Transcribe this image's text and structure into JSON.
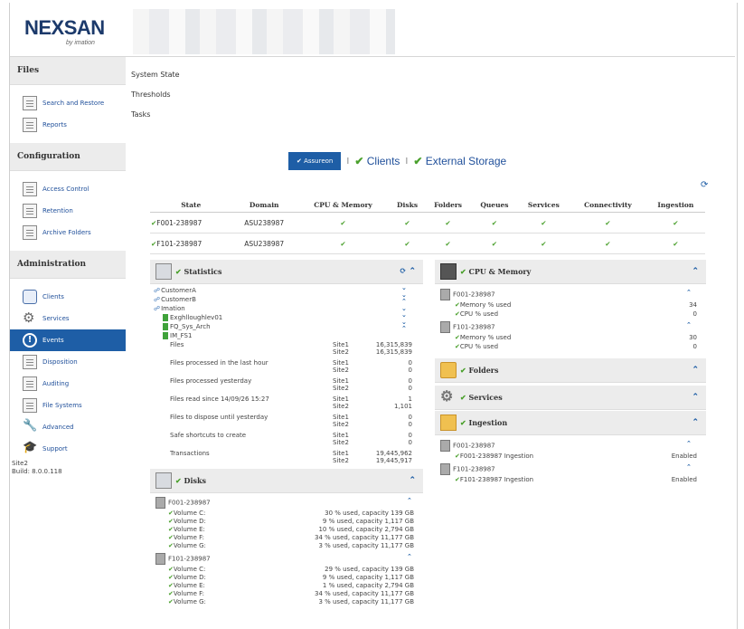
{
  "brand": {
    "name": "NEXSAN",
    "sub": "by imation"
  },
  "sidebar": {
    "sections": [
      {
        "title": "Files",
        "items": [
          {
            "label": "Search and Restore",
            "icon": "search-doc-icon"
          },
          {
            "label": "Reports",
            "icon": "reports-icon"
          }
        ]
      },
      {
        "title": "Configuration",
        "items": [
          {
            "label": "Access Control",
            "icon": "access-control-icon"
          },
          {
            "label": "Retention",
            "icon": "retention-icon"
          },
          {
            "label": "Archive Folders",
            "icon": "archive-folders-icon"
          }
        ]
      },
      {
        "title": "Administration",
        "items": [
          {
            "label": "Clients",
            "icon": "clients-icon"
          },
          {
            "label": "Services",
            "icon": "gear-icon"
          },
          {
            "label": "Events",
            "icon": "alert-icon",
            "active": true
          },
          {
            "label": "Disposition",
            "icon": "disposition-icon"
          },
          {
            "label": "Auditing",
            "icon": "auditing-icon"
          },
          {
            "label": "File Systems",
            "icon": "file-systems-icon"
          },
          {
            "label": "Advanced",
            "icon": "wrench-icon"
          },
          {
            "label": "Support",
            "icon": "support-icon"
          }
        ]
      }
    ],
    "site": "Site2",
    "build": "Build: 8.0.0.118"
  },
  "topmenu": [
    "System State",
    "Thresholds",
    "Tasks"
  ],
  "tabs": {
    "active": "Assureon",
    "t2": "Clients",
    "t3": "External Storage",
    "sep": "I"
  },
  "state_table": {
    "headers": [
      "State",
      "Domain",
      "CPU & Memory",
      "Disks",
      "Folders",
      "Queues",
      "Services",
      "Connectivity",
      "Ingestion"
    ],
    "rows": [
      {
        "state": "F001-238987",
        "domain": "ASU238987"
      },
      {
        "state": "F101-238987",
        "domain": "ASU238987"
      }
    ]
  },
  "statistics": {
    "title": "Statistics",
    "tree": [
      "CustomerA",
      "CustomerB",
      "Imation",
      "Exghlloughlev01",
      "FQ_Sys_Arch",
      "IM_FS1"
    ],
    "rows": [
      {
        "label": "Files",
        "s1": "Site1",
        "v1": "16,315,839",
        "s2": "Site2",
        "v2": "16,315,839"
      },
      {
        "label": "Files processed in the last hour",
        "s1": "Site1",
        "v1": "0",
        "s2": "Site2",
        "v2": "0"
      },
      {
        "label": "Files processed yesterday",
        "s1": "Site1",
        "v1": "0",
        "s2": "Site2",
        "v2": "0"
      },
      {
        "label": "Files read since 14/09/26 15:27",
        "s1": "Site1",
        "v1": "1",
        "s2": "Site2",
        "v2": "1,101"
      },
      {
        "label": "Files to dispose until yesterday",
        "s1": "Site1",
        "v1": "0",
        "s2": "Site2",
        "v2": "0"
      },
      {
        "label": "Safe shortcuts to create",
        "s1": "Site1",
        "v1": "0",
        "s2": "Site2",
        "v2": "0"
      },
      {
        "label": "Transactions",
        "s1": "Site1",
        "v1": "19,445,962",
        "s2": "Site2",
        "v2": "19,445,917"
      }
    ]
  },
  "disks": {
    "title": "Disks",
    "servers": [
      {
        "name": "F001-238987",
        "volumes": [
          {
            "name": "Volume C:",
            "usage": "30 % used, capacity 139 GB"
          },
          {
            "name": "Volume D:",
            "usage": "9 % used, capacity 1,117 GB"
          },
          {
            "name": "Volume E:",
            "usage": "10 % used, capacity 2,794 GB"
          },
          {
            "name": "Volume F:",
            "usage": "34 % used, capacity 11,177 GB"
          },
          {
            "name": "Volume G:",
            "usage": "3 % used, capacity 11,177 GB"
          }
        ]
      },
      {
        "name": "F101-238987",
        "volumes": [
          {
            "name": "Volume C:",
            "usage": "29 % used, capacity 139 GB"
          },
          {
            "name": "Volume D:",
            "usage": "9 % used, capacity 1,117 GB"
          },
          {
            "name": "Volume E:",
            "usage": "1 % used, capacity 2,794 GB"
          },
          {
            "name": "Volume F:",
            "usage": "34 % used, capacity 11,177 GB"
          },
          {
            "name": "Volume G:",
            "usage": "3 % used, capacity 11,177 GB"
          }
        ]
      }
    ]
  },
  "cpu_memory": {
    "title": "CPU & Memory",
    "servers": [
      {
        "name": "F001-238987",
        "mem_label": "Memory % used",
        "mem": "34",
        "cpu_label": "CPU % used",
        "cpu": "0"
      },
      {
        "name": "F101-238987",
        "mem_label": "Memory % used",
        "mem": "30",
        "cpu_label": "CPU % used",
        "cpu": "0"
      }
    ]
  },
  "folders": {
    "title": "Folders"
  },
  "services": {
    "title": "Services"
  },
  "ingestion": {
    "title": "Ingestion",
    "servers": [
      {
        "name": "F001-238987",
        "item": "F001-238987 Ingestion",
        "status": "Enabled"
      },
      {
        "name": "F101-238987",
        "item": "F101-238987 Ingestion",
        "status": "Enabled"
      }
    ]
  },
  "colors": {
    "accent": "#1e5ea6",
    "ok": "#4aa02c"
  }
}
